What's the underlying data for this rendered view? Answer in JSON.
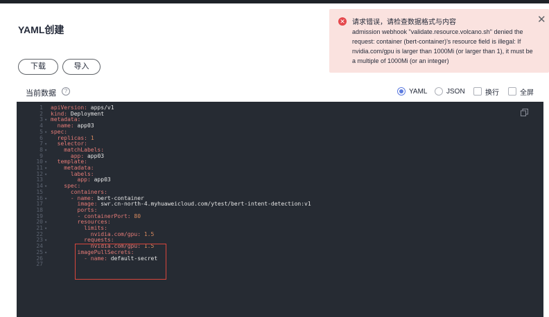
{
  "page": {
    "title": "YAML创建"
  },
  "toolbar": {
    "download_label": "下载",
    "import_label": "导入"
  },
  "section": {
    "label": "当前数据",
    "help_icon": "?"
  },
  "options": {
    "yaml": "YAML",
    "json": "JSON",
    "wrap": "换行",
    "fullscreen": "全屏",
    "selected": "YAML"
  },
  "toast": {
    "icon": "error-circle-icon",
    "icon_glyph": "✕",
    "title": "请求错误，请检查数据格式与内容",
    "message": "admission webhook \"validate.resource.volcano.sh\" denied the request: container (bert-container)'s resource field is illegal: If nvidia.com/gpu is larger than 1000Mi (or larger than 1), it must be a multiple of 1000Mi (or an integer)",
    "close": "✕"
  },
  "editor": {
    "lines": [
      {
        "n": "1",
        "fold": "",
        "indent": "",
        "key": "apiVersion:",
        "val": " apps/v1"
      },
      {
        "n": "2",
        "fold": "",
        "indent": "",
        "key": "kind:",
        "val": " Deployment"
      },
      {
        "n": "3",
        "fold": "▾",
        "indent": "",
        "key": "metadata:",
        "val": ""
      },
      {
        "n": "4",
        "fold": "",
        "indent": "  ",
        "key": "name:",
        "val": " app03"
      },
      {
        "n": "5",
        "fold": "▾",
        "indent": "",
        "key": "spec:",
        "val": ""
      },
      {
        "n": "6",
        "fold": "",
        "indent": "  ",
        "key": "replicas:",
        "val": " 1",
        "num": true
      },
      {
        "n": "7",
        "fold": "▾",
        "indent": "  ",
        "key": "selector:",
        "val": ""
      },
      {
        "n": "8",
        "fold": "▾",
        "indent": "    ",
        "key": "matchLabels:",
        "val": ""
      },
      {
        "n": "9",
        "fold": "",
        "indent": "      ",
        "key": "app:",
        "val": " app03"
      },
      {
        "n": "10",
        "fold": "▾",
        "indent": "  ",
        "key": "template:",
        "val": ""
      },
      {
        "n": "11",
        "fold": "▾",
        "indent": "    ",
        "key": "metadata:",
        "val": ""
      },
      {
        "n": "12",
        "fold": "▾",
        "indent": "      ",
        "key": "labels:",
        "val": ""
      },
      {
        "n": "13",
        "fold": "",
        "indent": "        ",
        "key": "app:",
        "val": " app03"
      },
      {
        "n": "14",
        "fold": "▾",
        "indent": "    ",
        "key": "spec:",
        "val": ""
      },
      {
        "n": "15",
        "fold": "",
        "indent": "      ",
        "key": "containers:",
        "val": ""
      },
      {
        "n": "16",
        "fold": "▾",
        "indent": "      ",
        "key": "- name:",
        "val": " bert-container"
      },
      {
        "n": "17",
        "fold": "",
        "indent": "        ",
        "key": "image:",
        "val": " swr.cn-north-4.myhuaweicloud.com/ytest/bert-intent-detection:v1"
      },
      {
        "n": "18",
        "fold": "",
        "indent": "        ",
        "key": "ports:",
        "val": ""
      },
      {
        "n": "19",
        "fold": "",
        "indent": "        ",
        "key": "- containerPort:",
        "val": " 80",
        "num": true
      },
      {
        "n": "20",
        "fold": "▾",
        "indent": "        ",
        "key": "resources:",
        "val": ""
      },
      {
        "n": "21",
        "fold": "▾",
        "indent": "          ",
        "key": "limits:",
        "val": ""
      },
      {
        "n": "22",
        "fold": "",
        "indent": "            ",
        "key": "nvidia.com/gpu:",
        "val": " 1.5",
        "num": true
      },
      {
        "n": "23",
        "fold": "▾",
        "indent": "          ",
        "key": "requests:",
        "val": ""
      },
      {
        "n": "24",
        "fold": "",
        "indent": "            ",
        "key": "nvidia.com/gpu:",
        "val": " 1.5",
        "num": true
      },
      {
        "n": "25",
        "fold": "▾",
        "indent": "        ",
        "key": "imagePullSecrets:",
        "val": ""
      },
      {
        "n": "26",
        "fold": "",
        "indent": "          ",
        "key": "- name:",
        "val": " default-secret"
      },
      {
        "n": "27",
        "fold": "",
        "indent": "",
        "key": "",
        "val": ""
      }
    ]
  }
}
